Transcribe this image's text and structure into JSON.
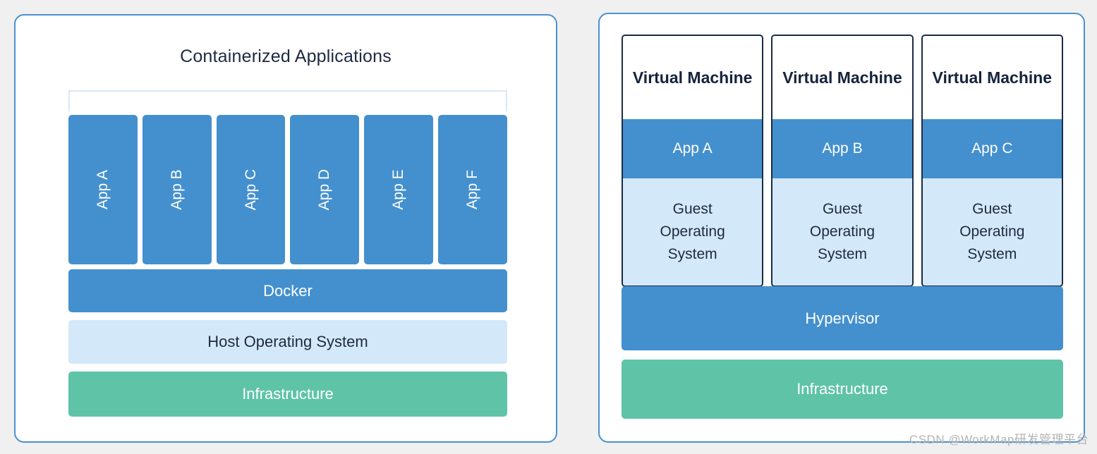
{
  "background_color": "#f0f0f0",
  "colors": {
    "panel_border": "#4a90d0",
    "blue": "#4490ce",
    "light_blue": "#d3e8f8",
    "green": "#5fc3a8",
    "navy": "#1b2b47",
    "bracket": "#d6e9f8"
  },
  "left_panel": {
    "title": "Containerized Applications",
    "apps": [
      {
        "label": "App A"
      },
      {
        "label": "App B"
      },
      {
        "label": "App C"
      },
      {
        "label": "App D"
      },
      {
        "label": "App E"
      },
      {
        "label": "App F"
      }
    ],
    "layers": [
      {
        "label": "Docker",
        "color": "#4490ce"
      },
      {
        "label": "Host Operating System",
        "color": "#d3e8f8"
      },
      {
        "label": "Infrastructure",
        "color": "#5fc3a8"
      }
    ],
    "docker_label": "Docker",
    "host_os_label": "Host Operating System",
    "infrastructure_label": "Infrastructure"
  },
  "right_panel": {
    "vms": [
      {
        "title": "Virtual Machine",
        "app": "App A",
        "guest_os": "Guest\nOperating\nSystem"
      },
      {
        "title": "Virtual Machine",
        "app": "App B",
        "guest_os": "Guest\nOperating\nSystem"
      },
      {
        "title": "Virtual Machine",
        "app": "App C",
        "guest_os": "Guest\nOperating\nSystem"
      }
    ],
    "hypervisor_label": "Hypervisor",
    "infrastructure_label": "Infrastructure"
  },
  "watermark": "CSDN @WorkMap研发管理平台"
}
